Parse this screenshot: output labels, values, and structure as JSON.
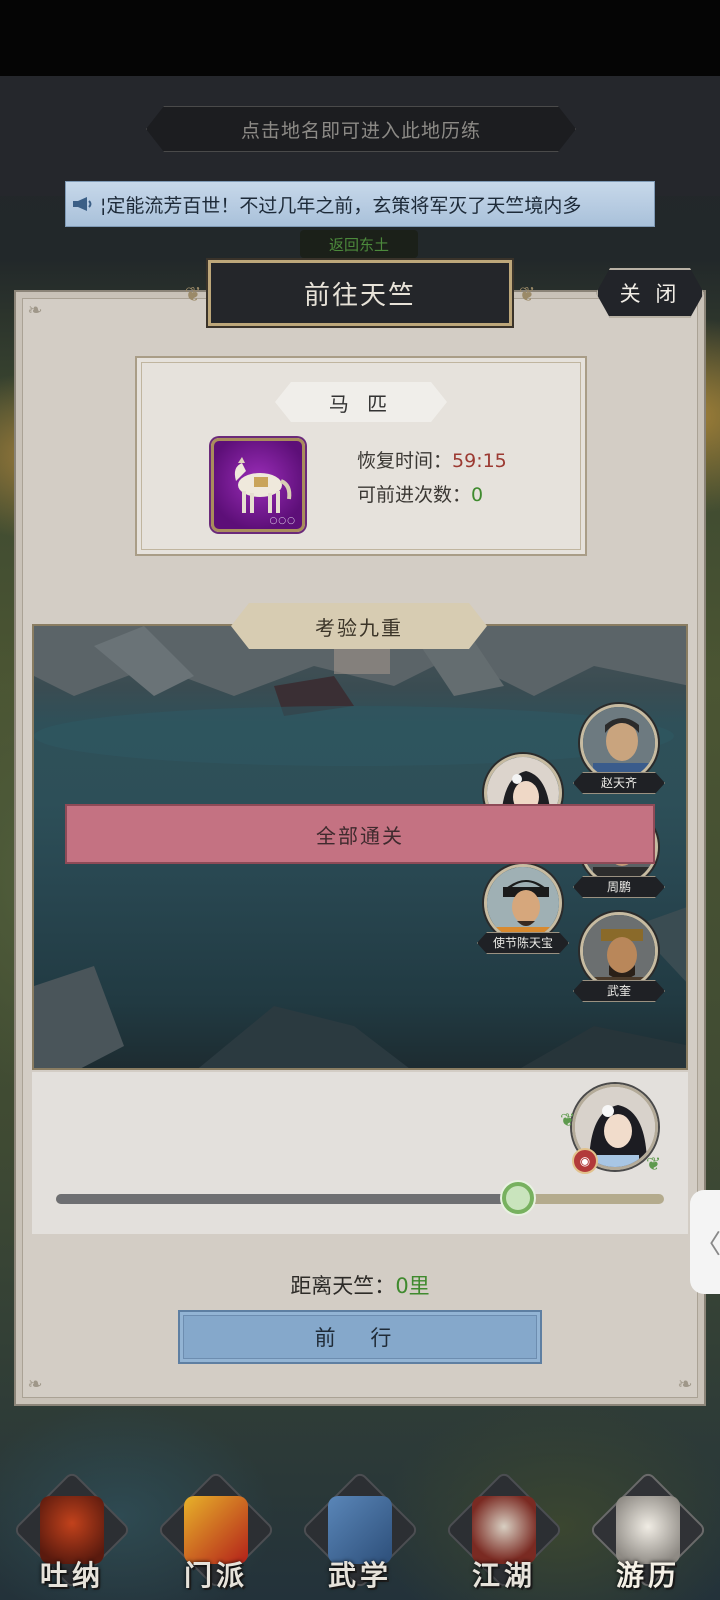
{
  "hint_banner": "点击地名即可进入此地历练",
  "ticker": {
    "text": "¦定能流芳百世！不过几年之前，玄策将军灭了天竺境内多",
    "icon": "megaphone-icon"
  },
  "return_label": "返回东土",
  "dialog": {
    "title": "前往天竺",
    "close_label": "关 闭",
    "horse": {
      "tag": "马 匹",
      "icon": "white-horse-icon",
      "recover_label": "恢复时间：",
      "recover_value": "59:15",
      "trips_label": "可前进次数：",
      "trips_value": "0"
    },
    "trial": {
      "title": "考验九重",
      "status": "全部通关",
      "npcs": [
        {
          "name": "赵天齐"
        },
        {
          "name": "周鹏"
        },
        {
          "name": "使节陈天宝"
        },
        {
          "name": "武奎"
        }
      ]
    },
    "progress": {
      "fraction": 0.76
    },
    "distance_label": "距离天竺：",
    "distance_value": "0里",
    "go_label": "前 行"
  },
  "bottom_nav": [
    {
      "label": "吐纳",
      "icon": "meditation-icon",
      "active": false
    },
    {
      "label": "门派",
      "icon": "sect-banner-icon",
      "active": false
    },
    {
      "label": "武学",
      "icon": "martial-books-icon",
      "active": false
    },
    {
      "label": "江湖",
      "icon": "straw-hat-icon",
      "active": false
    },
    {
      "label": "游历",
      "icon": "horse-travel-icon",
      "active": true
    }
  ],
  "colors": {
    "accent_green": "#3f8a2e",
    "accent_red": "#9c3a32",
    "banner_pink": "#c47282",
    "button_blue": "#85a8cb"
  }
}
